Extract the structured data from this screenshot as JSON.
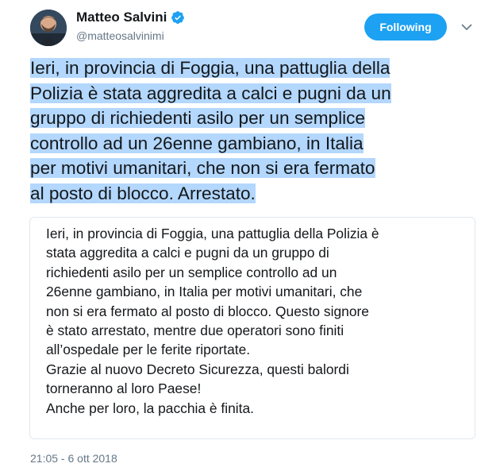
{
  "user": {
    "display_name": "Matteo Salvini",
    "handle": "@matteosalvinimi",
    "verified": true
  },
  "follow_button_label": "Following",
  "tweet": {
    "lines": [
      "Ieri, in provincia di Foggia, una pattuglia della",
      "Polizia è stata aggredita a calci e pugni da un",
      "gruppo di richiedenti asilo per un semplice",
      "controllo ad un 26enne gambiano, in Italia",
      "per motivi umanitari, che non si era fermato",
      "al posto di blocco. Arrestato."
    ],
    "highlight_color": "#b3d7fd"
  },
  "quote": {
    "lines": [
      "Ieri, in provincia di Foggia, una pattuglia della Polizia è",
      "stata aggredita a calci e pugni da un gruppo di",
      "richiedenti asilo per un semplice controllo ad un",
      "26enne gambiano, in Italia per motivi umanitari, che",
      "non si era fermato al posto di blocco. Questo signore",
      "è stato arrestato, mentre due operatori sono finiti",
      "all’ospedale per le ferite riportate.",
      "Grazie al nuovo Decreto Sicurezza, questi balordi",
      "torneranno al loro Paese!",
      "Anche per loro, la pacchia è finita."
    ]
  },
  "timestamp": "21:05 - 6 ott 2018",
  "icons": {
    "verified": "verified-badge-icon",
    "caret": "chevron-down-icon"
  },
  "colors": {
    "accent": "#1da1f2",
    "secondary_text": "#657786",
    "border": "#e1e8ed"
  }
}
